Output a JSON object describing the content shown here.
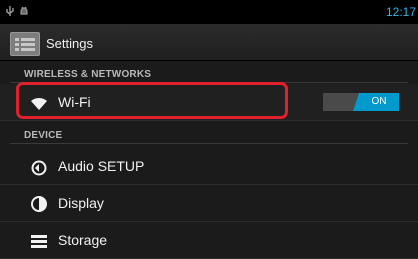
{
  "status": {
    "time": "12:17"
  },
  "actionbar": {
    "title": "Settings",
    "icon": "settings-app-icon"
  },
  "sections": {
    "wireless": "WIRELESS & NETWORKS",
    "device": "DEVICE"
  },
  "items": {
    "wifi": {
      "label": "Wi-Fi",
      "icon": "wifi-icon",
      "toggle": "ON"
    },
    "audio": {
      "label": "Audio SETUP",
      "icon": "audio-icon"
    },
    "display": {
      "label": "Display",
      "icon": "display-icon"
    },
    "storage": {
      "label": "Storage",
      "icon": "storage-icon"
    }
  },
  "colors": {
    "accent": "#33b5e5",
    "toggle_on": "#0099cc",
    "highlight": "#e0202c"
  }
}
